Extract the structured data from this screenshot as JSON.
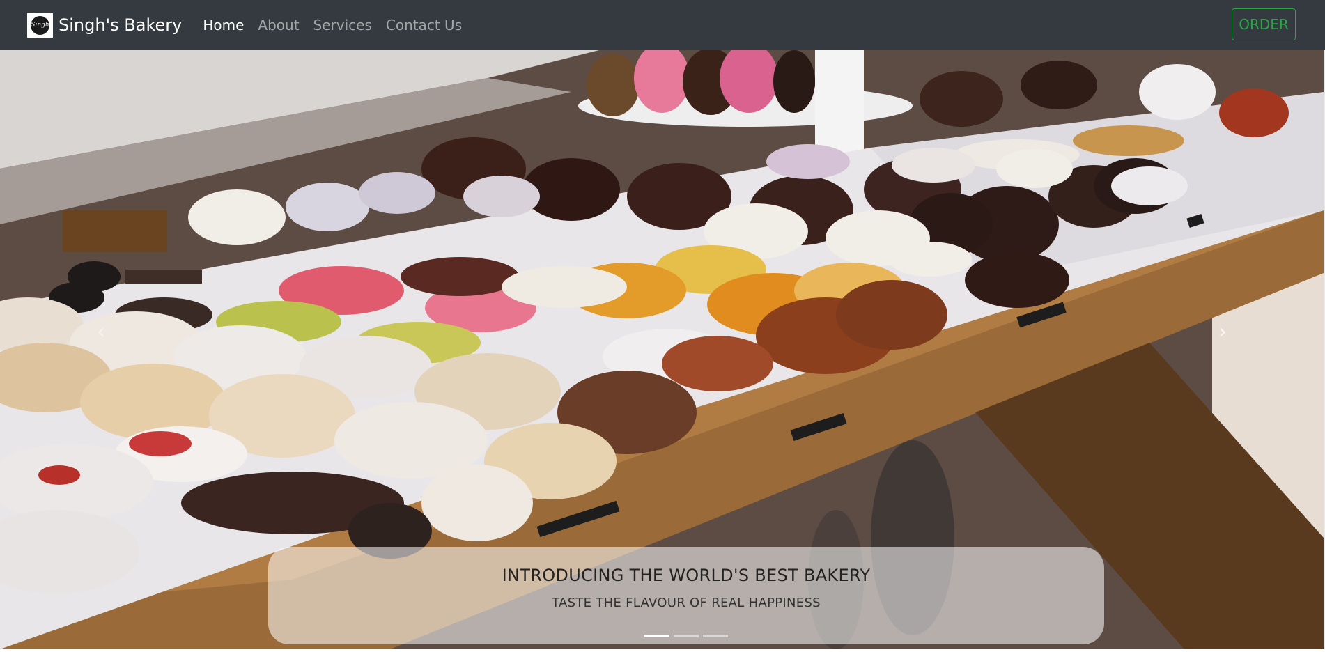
{
  "navbar": {
    "brand": "Singh's Bakery",
    "logo_text": "Singh",
    "links": [
      {
        "label": "Home",
        "active": true
      },
      {
        "label": "About",
        "active": false
      },
      {
        "label": "Services",
        "active": false
      },
      {
        "label": "Contact Us",
        "active": false
      }
    ],
    "order_label": "ORDER"
  },
  "carousel": {
    "caption_title": "INTRODUCING THE WORLD'S BEST BAKERY",
    "caption_text": "TASTE THE FLAVOUR OF REAL HAPPINESS",
    "prev_icon": "‹",
    "next_icon": "›",
    "slide_count": 3,
    "active_slide": 1,
    "image": {
      "name": "bakery-display-photo",
      "colors": {
        "table": "#8a5a2e",
        "tray": "#e8e6e8",
        "frosting": "#f1eeec",
        "chocolate": "#3a1f1a",
        "pink": "#e56f93",
        "caramel": "#e59a2f"
      }
    }
  },
  "colors": {
    "navbar": "#343a40",
    "accent": "#28a745"
  }
}
